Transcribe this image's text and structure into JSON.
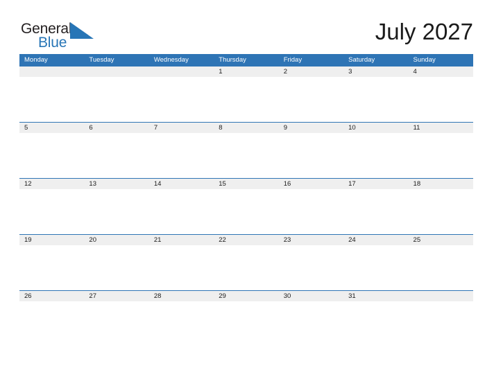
{
  "brand": {
    "name_part1": "General",
    "name_part2": "Blue",
    "triangle_color": "#2775b6",
    "text_color": "#231f20"
  },
  "header": {
    "title": "July 2027"
  },
  "theme": {
    "header_blue": "#2e74b5",
    "band_gray": "#efefef",
    "rule_blue": "#2e74b5",
    "text_dark": "#1a1a1a",
    "page_background": "#ffffff"
  },
  "calendar": {
    "month": "July",
    "year": "2027",
    "week_start": "Monday",
    "weekdays": [
      "Monday",
      "Tuesday",
      "Wednesday",
      "Thursday",
      "Friday",
      "Saturday",
      "Sunday"
    ],
    "weeks": [
      {
        "days": [
          "",
          "",
          "",
          "1",
          "2",
          "3",
          "4"
        ]
      },
      {
        "days": [
          "5",
          "6",
          "7",
          "8",
          "9",
          "10",
          "11"
        ]
      },
      {
        "days": [
          "12",
          "13",
          "14",
          "15",
          "16",
          "17",
          "18"
        ]
      },
      {
        "days": [
          "19",
          "20",
          "21",
          "22",
          "23",
          "24",
          "25"
        ]
      },
      {
        "days": [
          "26",
          "27",
          "28",
          "29",
          "30",
          "31",
          ""
        ]
      }
    ]
  }
}
